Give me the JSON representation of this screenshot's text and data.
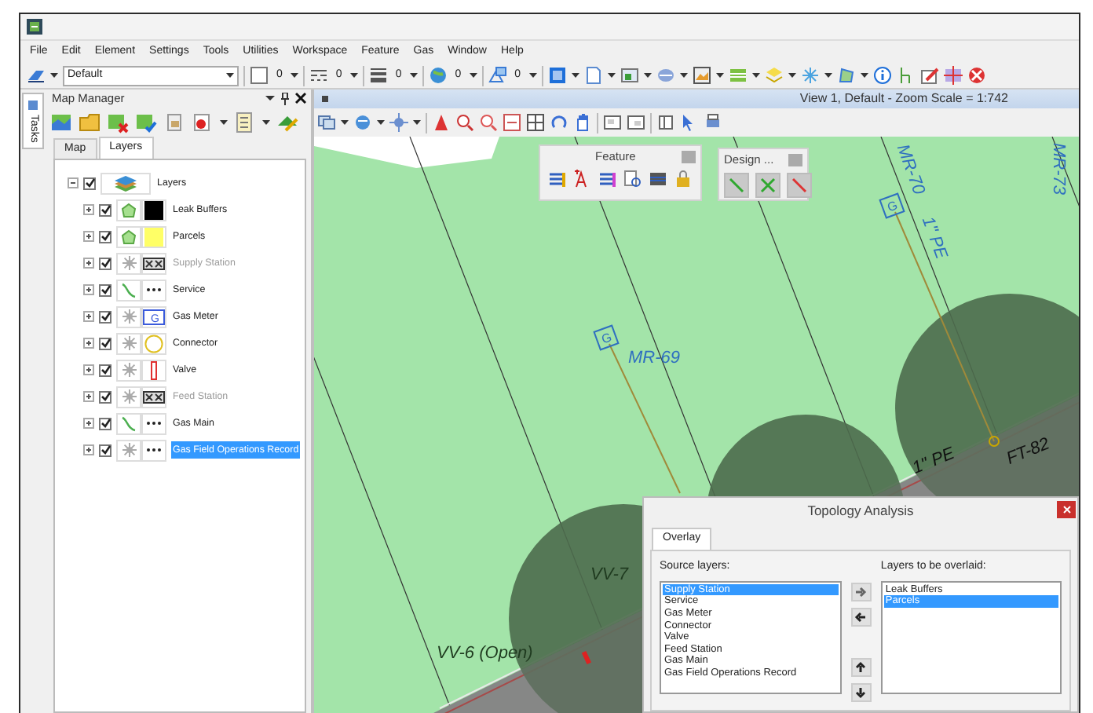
{
  "menu": [
    "File",
    "Edit",
    "Element",
    "Settings",
    "Tools",
    "Utilities",
    "Workspace",
    "Feature",
    "Gas",
    "Window",
    "Help"
  ],
  "toolbar": {
    "level": "Default",
    "counts": [
      "0",
      "0",
      "0",
      "0",
      "0"
    ]
  },
  "map_manager": {
    "title": "Map Manager",
    "side_tab": "Tasks",
    "tabs": [
      {
        "label": "Map",
        "selected": false
      },
      {
        "label": "Layers",
        "selected": true
      }
    ],
    "tree": {
      "label": "Layers",
      "expanded": true,
      "checked": true,
      "children": [
        {
          "label": "Leak Buffers",
          "kind": "area",
          "color": "#000000",
          "checked": true,
          "expanded": false,
          "disabled": false,
          "selected": false
        },
        {
          "label": "Parcels",
          "kind": "area",
          "color": "#ffff66",
          "checked": true,
          "expanded": false,
          "disabled": false,
          "selected": false
        },
        {
          "label": "Supply Station",
          "kind": "station",
          "checked": true,
          "expanded": false,
          "disabled": true,
          "selected": false
        },
        {
          "label": "Service",
          "kind": "line",
          "checked": true,
          "expanded": false,
          "disabled": false,
          "selected": false
        },
        {
          "label": "Gas Meter",
          "kind": "meter",
          "symbol_text": "G",
          "checked": true,
          "expanded": false,
          "disabled": false,
          "selected": false
        },
        {
          "label": "Connector",
          "kind": "connector",
          "checked": true,
          "expanded": false,
          "disabled": false,
          "selected": false
        },
        {
          "label": "Valve",
          "kind": "valve",
          "checked": true,
          "expanded": false,
          "disabled": false,
          "selected": false
        },
        {
          "label": "Feed Station",
          "kind": "station",
          "checked": true,
          "expanded": false,
          "disabled": true,
          "selected": false
        },
        {
          "label": "Gas Main",
          "kind": "line",
          "checked": true,
          "expanded": false,
          "disabled": false,
          "selected": false
        },
        {
          "label": "Gas Field Operations Record",
          "kind": "record",
          "checked": true,
          "expanded": false,
          "disabled": false,
          "selected": true
        }
      ]
    }
  },
  "view": {
    "title": "View 1, Default - Zoom Scale = 1:742",
    "meter_symbols": [
      "G",
      "G"
    ],
    "labels": [
      {
        "text": "MR-73",
        "kind": "meter"
      },
      {
        "text": "MR-70",
        "kind": "meter"
      },
      {
        "text": "1\" PE",
        "kind": "meter"
      },
      {
        "text": "MR-69",
        "kind": "meter"
      },
      {
        "text": "FT-82",
        "kind": "main"
      },
      {
        "text": "1\" PE",
        "kind": "main"
      },
      {
        "text": "VV-7",
        "kind": "valve"
      },
      {
        "text": "VV-6 (Open)",
        "kind": "valve"
      }
    ]
  },
  "feature_toolbar": {
    "title": "Feature"
  },
  "design_toolbar": {
    "title": "Design ..."
  },
  "topology_dialog": {
    "title": "Topology Analysis",
    "tabs": [
      {
        "label": "Overlay",
        "selected": true
      }
    ],
    "source_label": "Source layers:",
    "source_layers": [
      {
        "label": "Supply Station",
        "selected": true
      },
      {
        "label": "Service",
        "selected": false
      },
      {
        "label": "Gas Meter",
        "selected": false
      },
      {
        "label": "Connector",
        "selected": false
      },
      {
        "label": "Valve",
        "selected": false
      },
      {
        "label": "Feed Station",
        "selected": false
      },
      {
        "label": "Gas Main",
        "selected": false
      },
      {
        "label": "Gas Field Operations Record",
        "selected": false
      }
    ],
    "target_label": "Layers to be overlaid:",
    "target_layers": [
      {
        "label": "Leak Buffers",
        "selected": false
      },
      {
        "label": "Parcels",
        "selected": true
      }
    ]
  }
}
